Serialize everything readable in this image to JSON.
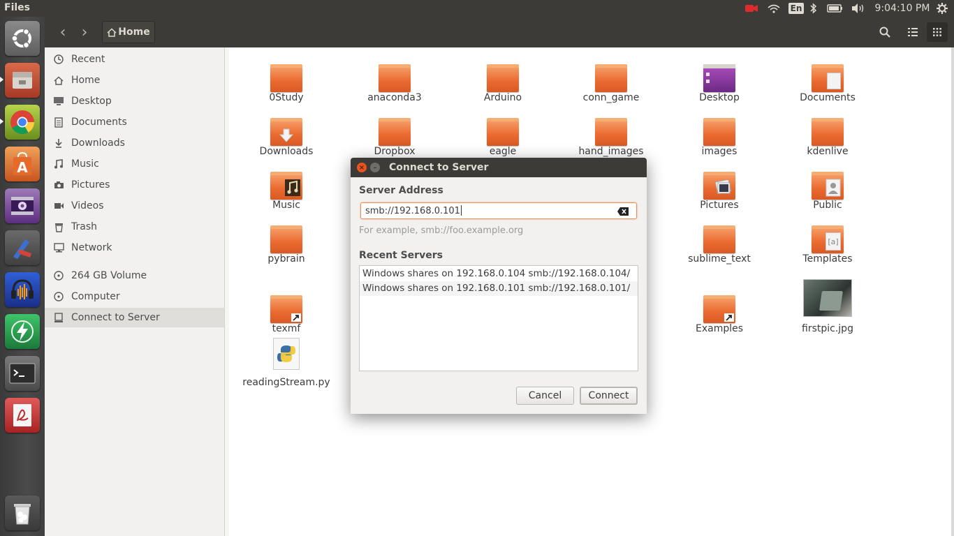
{
  "topbar": {
    "app_title": "Files",
    "keyboard": "En",
    "clock": "9:04:10 PM"
  },
  "launcher": {
    "items": [
      {
        "name": "ubuntu-dash-icon"
      },
      {
        "name": "files-app-icon"
      },
      {
        "name": "chrome-icon"
      },
      {
        "name": "software-center-icon"
      },
      {
        "name": "video-player-icon"
      },
      {
        "name": "spyder-icon"
      },
      {
        "name": "audacity-icon"
      },
      {
        "name": "energy-app-icon"
      },
      {
        "name": "terminal-icon"
      },
      {
        "name": "document-viewer-icon"
      },
      {
        "name": "trash-icon"
      }
    ]
  },
  "header": {
    "path_label": "Home"
  },
  "sidebar": {
    "items": [
      {
        "label": "Recent",
        "icon": "clock-icon"
      },
      {
        "label": "Home",
        "icon": "home-icon"
      },
      {
        "label": "Desktop",
        "icon": "desktop-icon"
      },
      {
        "label": "Documents",
        "icon": "documents-icon"
      },
      {
        "label": "Downloads",
        "icon": "download-icon"
      },
      {
        "label": "Music",
        "icon": "music-icon"
      },
      {
        "label": "Pictures",
        "icon": "camera-icon"
      },
      {
        "label": "Videos",
        "icon": "video-icon"
      },
      {
        "label": "Trash",
        "icon": "trash-icon"
      },
      {
        "label": "Network",
        "icon": "network-icon"
      },
      {
        "label": "264 GB Volume",
        "icon": "disk-icon"
      },
      {
        "label": "Computer",
        "icon": "disk-icon"
      },
      {
        "label": "Connect to Server",
        "icon": "server-icon"
      }
    ]
  },
  "files": [
    {
      "label": "0Study"
    },
    {
      "label": "anaconda3"
    },
    {
      "label": "Arduino"
    },
    {
      "label": "conn_game"
    },
    {
      "label": "Desktop"
    },
    {
      "label": "Documents"
    },
    {
      "label": "Downloads"
    },
    {
      "label": "Dropbox"
    },
    {
      "label": "eagle"
    },
    {
      "label": "hand_images"
    },
    {
      "label": "images"
    },
    {
      "label": "kdenlive"
    },
    {
      "label": "Music"
    },
    {
      "label": "Pictures"
    },
    {
      "label": "Public"
    },
    {
      "label": "pybrain"
    },
    {
      "label": "sublime_text"
    },
    {
      "label": "Templates"
    },
    {
      "label": "texmf"
    },
    {
      "label": "Examples"
    },
    {
      "label": "firstpic.jpg"
    },
    {
      "label": "readingStream.py"
    }
  ],
  "dialog": {
    "title": "Connect to Server",
    "server_address_label": "Server Address",
    "server_address_value": "smb://192.168.0.101",
    "hint": "For example, smb://foo.example.org",
    "recent_label": "Recent Servers",
    "recent_servers": [
      {
        "text": "Windows shares on 192.168.0.104  smb://192.168.0.104/"
      },
      {
        "text": "Windows shares on 192.168.0.101  smb://192.168.0.101/"
      }
    ],
    "cancel_label": "Cancel",
    "connect_label": "Connect"
  },
  "colors": {
    "accent": "#e95420",
    "folder": "#ef7a3f",
    "panel": "#3c3b37"
  }
}
